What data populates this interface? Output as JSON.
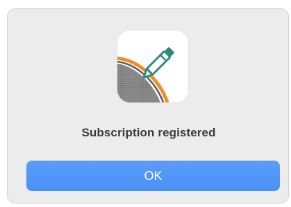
{
  "dialog": {
    "icon": "app-pen-icon",
    "message": "Subscription registered",
    "ok_label": "OK"
  },
  "colors": {
    "button_blue": "#4a90f4",
    "pen_green": "#2f8a7e",
    "accent_orange": "#ee8f2b"
  }
}
